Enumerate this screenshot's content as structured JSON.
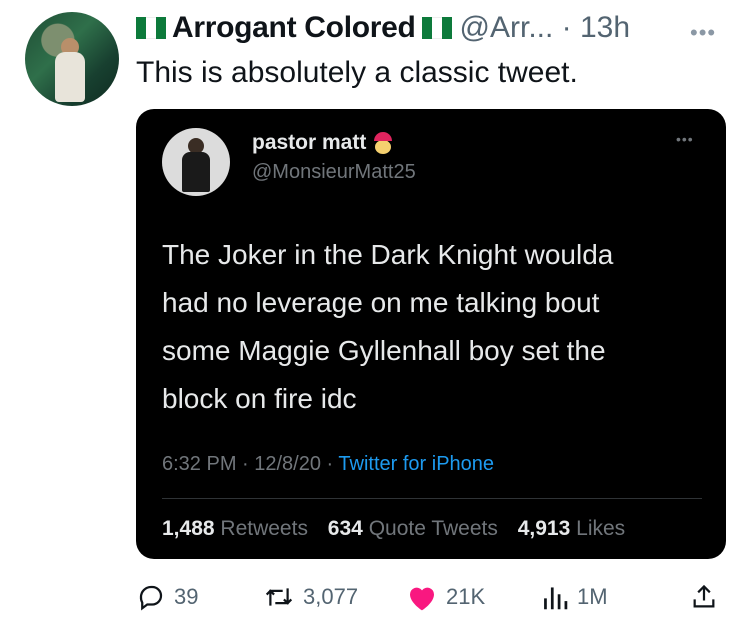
{
  "tweet": {
    "author_name": "Arrogant Colored",
    "handle_time": "@Arr... · 13h",
    "text": "This is absolutely a classic tweet."
  },
  "quoted": {
    "name": "pastor matt",
    "handle": "@MonsieurMatt25",
    "lines": [
      "The Joker in the Dark Knight woulda",
      "had no leverage on me talking bout",
      "some Maggie Gyllenhall boy set the",
      "block on fire idc"
    ],
    "timestamp": "6:32 PM · 12/8/20 · ",
    "source": "Twitter for iPhone",
    "stats": {
      "retweets_count": "1,488",
      "retweets_label": "Retweets",
      "quotes_count": "634",
      "quotes_label": "Quote Tweets",
      "likes_count": "4,913",
      "likes_label": "Likes"
    }
  },
  "actions": {
    "replies": "39",
    "retweets": "3,077",
    "likes": "21K",
    "views": "1M"
  },
  "colors": {
    "like": "#f91880",
    "link": "#1d9bf0",
    "flag_green": "#0d7a3b"
  },
  "icons": [
    "reply-icon",
    "retweet-icon",
    "like-icon",
    "views-icon",
    "share-icon",
    "more-icon"
  ]
}
